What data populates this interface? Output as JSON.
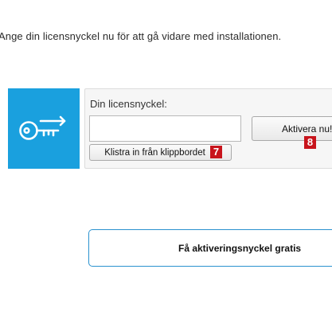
{
  "instruction": "Ange din licensnyckel nu för att gå vidare med installationen.",
  "license": {
    "label": "Din licensnyckel:",
    "input_value": "",
    "input_placeholder": "",
    "activate_label": "Aktivera nu!",
    "paste_label": "Klistra in från klippbordet"
  },
  "hint_badges": {
    "paste": "7",
    "activate": "8"
  },
  "free_key_label": "Få aktiveringsnyckel gratis",
  "icon": "key-arrow-icon",
  "colors": {
    "tile": "#1aa0de",
    "badge": "#c8141c",
    "free_key_border": "#2a92cf"
  }
}
